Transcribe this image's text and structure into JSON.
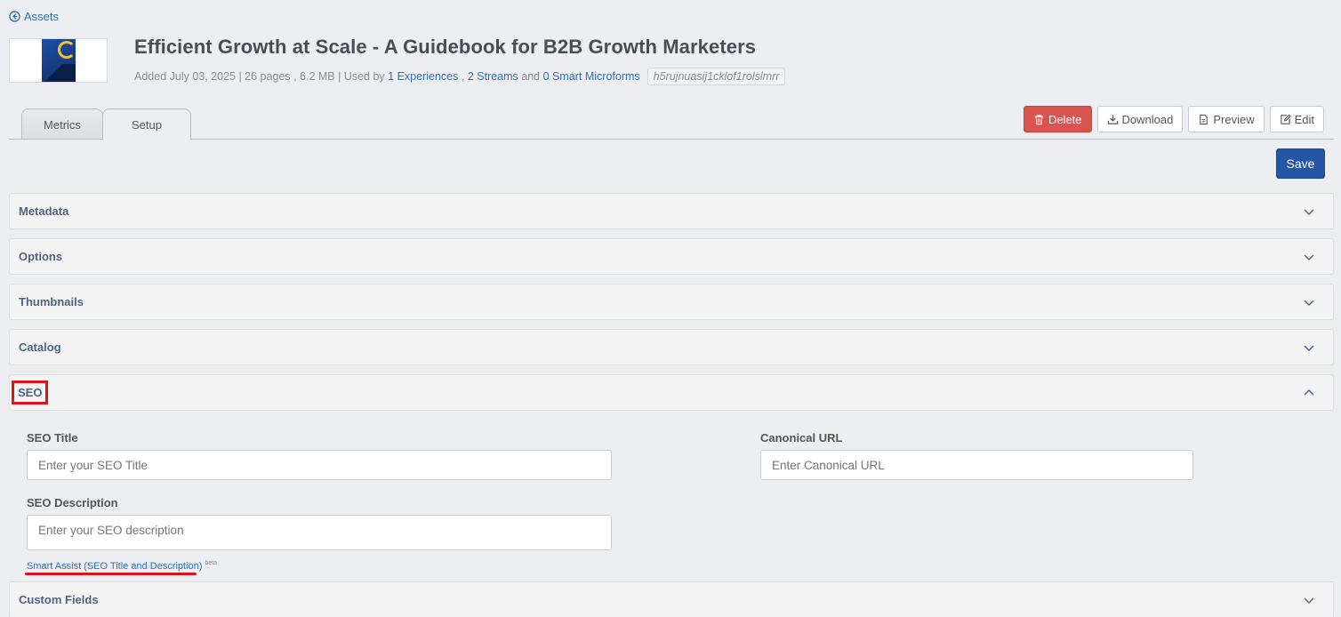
{
  "nav": {
    "back_label": "Assets"
  },
  "asset": {
    "title": "Efficient Growth at Scale - A Guidebook for B2B Growth Marketers",
    "meta_prefix": "Added July 03, 2025 | 26 pages , 6.2 MB | Used by",
    "experiences_link": "1 Experiences",
    "sep1": ",",
    "streams_link": "2 Streams",
    "and_text": "and",
    "microforms_link": "0 Smart Microforms",
    "hash": "h5rujnuasij1cklof1rolslmrr"
  },
  "tabs": [
    {
      "label": "Metrics",
      "active": false
    },
    {
      "label": "Setup",
      "active": true
    }
  ],
  "actions": {
    "delete": "Delete",
    "download": "Download",
    "preview": "Preview",
    "edit": "Edit",
    "save": "Save"
  },
  "panels": {
    "metadata": "Metadata",
    "options": "Options",
    "thumbnails": "Thumbnails",
    "catalog": "Catalog",
    "seo": "SEO",
    "custom_fields": "Custom Fields"
  },
  "seo": {
    "title_label": "SEO Title",
    "title_placeholder": "Enter your SEO Title",
    "canonical_label": "Canonical URL",
    "canonical_placeholder": "Enter Canonical URL",
    "description_label": "SEO Description",
    "description_placeholder": "Enter your SEO description",
    "smart_assist": "Smart Assist (SEO Title and Description)",
    "beta": "beta"
  },
  "colors": {
    "accent": "#2456a5",
    "link": "#2d72b8",
    "danger": "#d9534f",
    "highlight": "#e0131c"
  }
}
